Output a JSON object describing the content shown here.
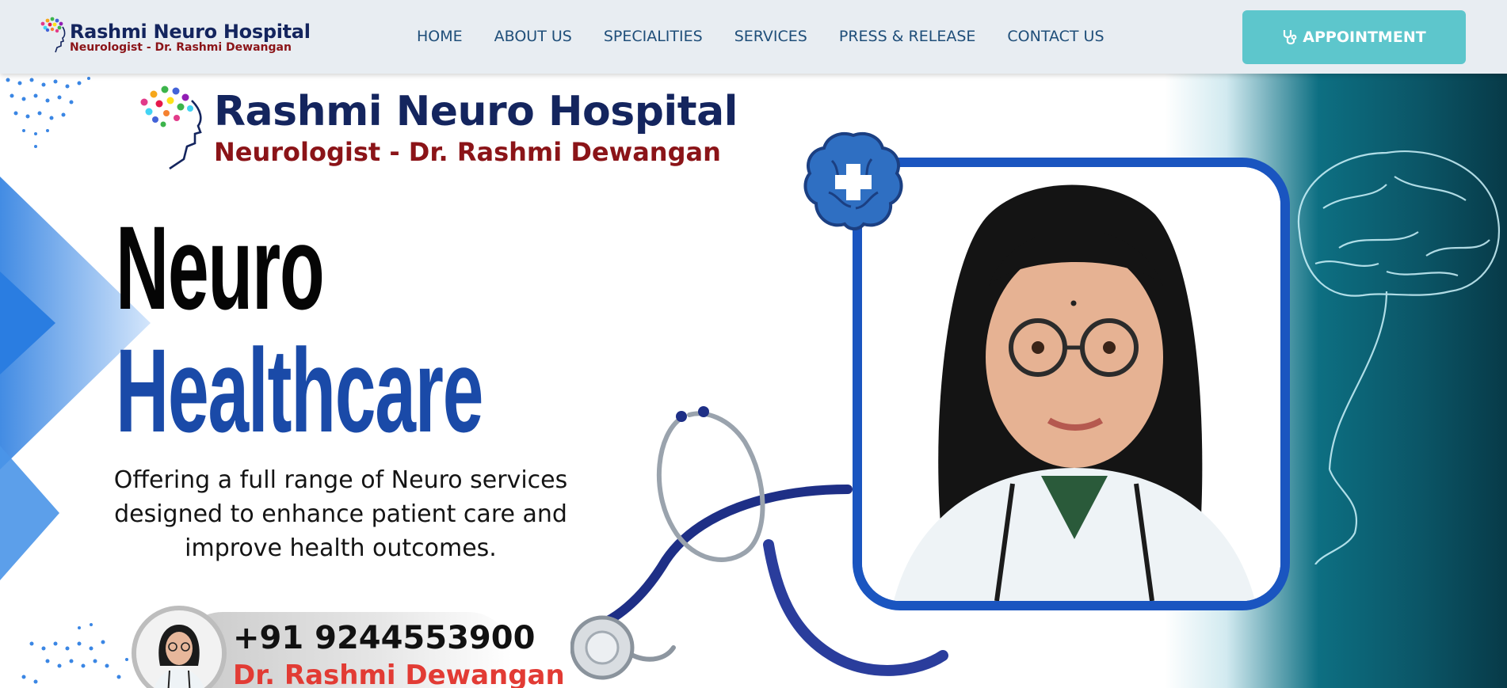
{
  "header": {
    "logo": {
      "name": "Rashmi Neuro Hospital",
      "subtitle": "Neurologist - Dr. Rashmi Dewangan"
    },
    "nav": [
      {
        "label": "HOME"
      },
      {
        "label": "ABOUT US"
      },
      {
        "label": "SPECIALITIES"
      },
      {
        "label": "SERVICES"
      },
      {
        "label": "PRESS & RELEASE"
      },
      {
        "label": "CONTACT US"
      }
    ],
    "appointment_label": "APPOINTMENT",
    "appointment_icon": "stethoscope-icon"
  },
  "hero": {
    "logo": {
      "name": "Rashmi Neuro Hospital",
      "subtitle": "Neurologist - Dr. Rashmi Dewangan"
    },
    "heading_line1": "Neuro",
    "heading_line2": "Healthcare",
    "tagline": "Offering a full range of Neuro services designed to enhance patient care and improve health outcomes.",
    "phone": "+91 9244553900",
    "doctor_name": "Dr. Rashmi Dewangan",
    "badge_icon": "brain-plus-icon"
  },
  "colors": {
    "nav_text": "#1f4e79",
    "appointment_bg": "#5dc6cc",
    "brand_navy": "#14255e",
    "brand_red": "#8b1418",
    "heading_blue": "#1a4aa8",
    "frame_blue": "#1a55c0",
    "doctor_name_red": "#e23b34",
    "teal_bg": "#0d6f82"
  }
}
